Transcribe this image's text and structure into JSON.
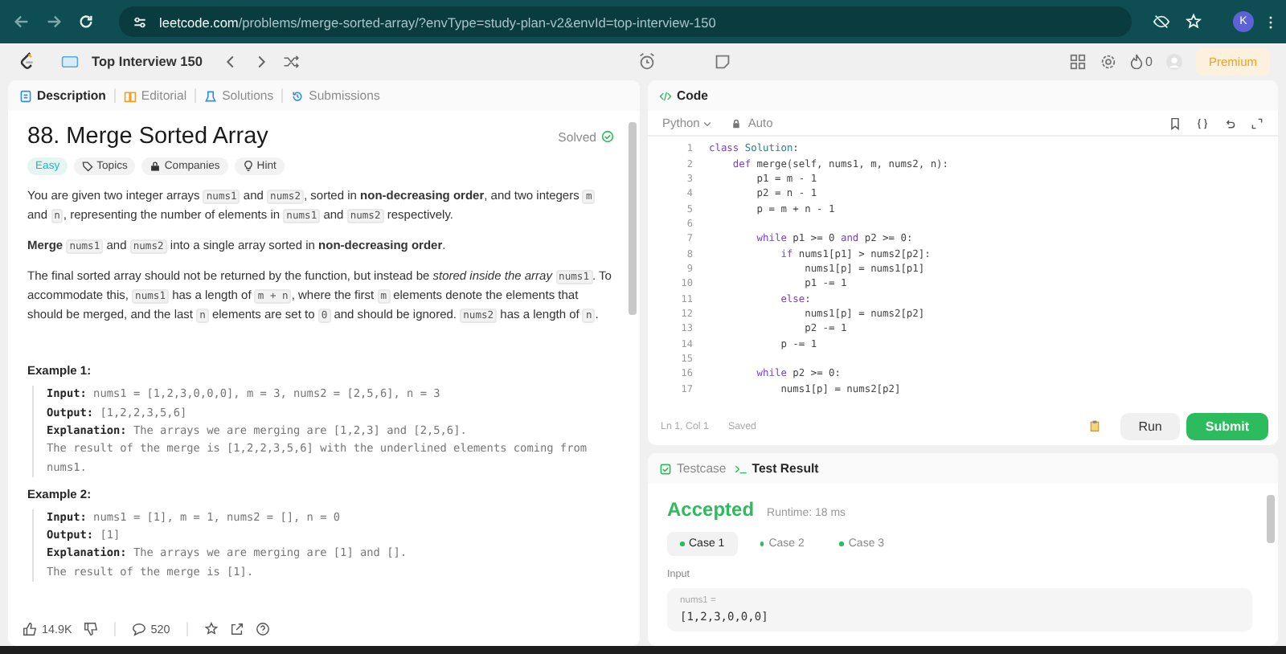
{
  "browser": {
    "url_host": "leetcode.com",
    "url_path": "/problems/merge-sorted-array/?envType=study-plan-v2&envId=top-interview-150",
    "profile_initial": "K"
  },
  "header": {
    "study_plan": "Top Interview 150",
    "streak": "0",
    "premium": "Premium"
  },
  "description_tabs": [
    {
      "label": "Description",
      "kind": "description",
      "selected": true
    },
    {
      "label": "Editorial",
      "kind": "editorial",
      "selected": false
    },
    {
      "label": "Solutions",
      "kind": "solutions",
      "selected": false
    },
    {
      "label": "Submissions",
      "kind": "submissions",
      "selected": false
    }
  ],
  "problem": {
    "title": "88. Merge Sorted Array",
    "status": "Solved",
    "tags": [
      {
        "label": "Easy",
        "kind": "difficulty"
      },
      {
        "label": "Topics",
        "kind": "topics"
      },
      {
        "label": "Companies",
        "kind": "companies"
      },
      {
        "label": "Hint",
        "kind": "hint"
      }
    ],
    "paragraphs": [
      [
        {
          "kind": "text",
          "text": "You are given two integer arrays "
        },
        {
          "kind": "code",
          "text": "nums1"
        },
        {
          "kind": "text",
          "text": " and "
        },
        {
          "kind": "code",
          "text": "nums2"
        },
        {
          "kind": "text",
          "text": ", sorted in "
        },
        {
          "kind": "bold",
          "text": "non-decreasing order"
        },
        {
          "kind": "text",
          "text": ", and two integers "
        },
        {
          "kind": "code",
          "text": "m"
        },
        {
          "kind": "text",
          "text": " and "
        },
        {
          "kind": "code",
          "text": "n"
        },
        {
          "kind": "text",
          "text": ", representing the number of elements in "
        },
        {
          "kind": "code",
          "text": "nums1"
        },
        {
          "kind": "text",
          "text": " and "
        },
        {
          "kind": "code",
          "text": "nums2"
        },
        {
          "kind": "text",
          "text": " respectively."
        }
      ],
      [
        {
          "kind": "bold",
          "text": "Merge "
        },
        {
          "kind": "code",
          "text": "nums1"
        },
        {
          "kind": "text",
          "text": " and "
        },
        {
          "kind": "code",
          "text": "nums2"
        },
        {
          "kind": "text",
          "text": " into a single array sorted in "
        },
        {
          "kind": "bold",
          "text": "non-decreasing order"
        },
        {
          "kind": "text",
          "text": "."
        }
      ],
      [
        {
          "kind": "text",
          "text": "The final sorted array should not be returned by the function, but instead be "
        },
        {
          "kind": "italic",
          "text": "stored inside the array "
        },
        {
          "kind": "code",
          "text": "nums1"
        },
        {
          "kind": "text",
          "text": ". To accommodate this, "
        },
        {
          "kind": "code",
          "text": "nums1"
        },
        {
          "kind": "text",
          "text": " has a length of "
        },
        {
          "kind": "code",
          "text": "m + n"
        },
        {
          "kind": "text",
          "text": ", where the first "
        },
        {
          "kind": "code",
          "text": "m"
        },
        {
          "kind": "text",
          "text": " elements denote the elements that should be merged, and the last "
        },
        {
          "kind": "code",
          "text": "n"
        },
        {
          "kind": "text",
          "text": " elements are set to "
        },
        {
          "kind": "code",
          "text": "0"
        },
        {
          "kind": "text",
          "text": " and should be ignored. "
        },
        {
          "kind": "code",
          "text": "nums2"
        },
        {
          "kind": "text",
          "text": " has a length of "
        },
        {
          "kind": "code",
          "text": "n"
        },
        {
          "kind": "text",
          "text": "."
        }
      ]
    ],
    "examples": [
      {
        "title": "Example 1:",
        "lines": [
          {
            "label": "Input:",
            "text": " nums1 = [1,2,3,0,0,0], m = 3, nums2 = [2,5,6], n = 3"
          },
          {
            "label": "Output:",
            "text": " [1,2,2,3,5,6]"
          },
          {
            "label": "Explanation:",
            "text": " The arrays we are merging are [1,2,3] and [2,5,6]."
          },
          {
            "text": "The result of the merge is [1,2,2,3,5,6] with the underlined elements coming from nums1."
          }
        ]
      },
      {
        "title": "Example 2:",
        "lines": [
          {
            "label": "Input:",
            "text": " nums1 = [1], m = 1, nums2 = [], n = 0"
          },
          {
            "label": "Output:",
            "text": " [1]"
          },
          {
            "label": "Explanation:",
            "text": " The arrays we are merging are [1] and []."
          },
          {
            "text": "The result of the merge is [1]."
          }
        ]
      }
    ]
  },
  "footer": {
    "likes": "14.9K",
    "comments": "520"
  },
  "editor": {
    "tab": "Code",
    "language": "Python",
    "mode": "Auto",
    "cursor": "Ln 1, Col 1",
    "save_state": "Saved",
    "run": "Run",
    "submit": "Submit",
    "lines": [
      {
        "n": "1",
        "code": [
          {
            "kind": "kw",
            "text": "class"
          },
          {
            "kind": "type",
            "text": " Solution"
          },
          {
            "kind": "plain",
            "text": ":"
          }
        ]
      },
      {
        "n": "2",
        "code": [
          {
            "kind": "kw",
            "text": "    def"
          },
          {
            "kind": "plain",
            "text": " merge(self, nums1, m, nums2, n):"
          }
        ]
      },
      {
        "n": "3",
        "code": [
          {
            "kind": "plain",
            "text": "        p1 = m - 1"
          }
        ]
      },
      {
        "n": "4",
        "code": [
          {
            "kind": "plain",
            "text": "        p2 = n - 1"
          }
        ]
      },
      {
        "n": "5",
        "code": [
          {
            "kind": "plain",
            "text": "        p = m + n - 1"
          }
        ]
      },
      {
        "n": "6"
      },
      {
        "n": "7",
        "code": [
          {
            "kind": "kw",
            "text": "        while"
          },
          {
            "kind": "plain",
            "text": " p1 >= 0 "
          },
          {
            "kind": "kw",
            "text": "and"
          },
          {
            "kind": "plain",
            "text": " p2 >= 0:"
          }
        ]
      },
      {
        "n": "8",
        "code": [
          {
            "kind": "kw",
            "text": "            if"
          },
          {
            "kind": "plain",
            "text": " nums1[p1] > nums2[p2]:"
          }
        ]
      },
      {
        "n": "9",
        "code": [
          {
            "kind": "plain",
            "text": "                nums1[p] = nums1[p1]"
          }
        ]
      },
      {
        "n": "10",
        "code": [
          {
            "kind": "plain",
            "text": "                p1 -= 1"
          }
        ]
      },
      {
        "n": "11",
        "code": [
          {
            "kind": "kw",
            "text": "            else"
          },
          {
            "kind": "plain",
            "text": ":"
          }
        ]
      },
      {
        "n": "12",
        "code": [
          {
            "kind": "plain",
            "text": "                nums1[p] = nums2[p2]"
          }
        ]
      },
      {
        "n": "13",
        "code": [
          {
            "kind": "plain",
            "text": "                p2 -= 1"
          }
        ]
      },
      {
        "n": "14",
        "code": [
          {
            "kind": "plain",
            "text": "            p -= 1"
          }
        ]
      },
      {
        "n": "15"
      },
      {
        "n": "16",
        "code": [
          {
            "kind": "kw",
            "text": "        while"
          },
          {
            "kind": "plain",
            "text": " p2 >= 0:"
          }
        ]
      },
      {
        "n": "17",
        "code": [
          {
            "kind": "plain",
            "text": "            nums1[p] = nums2[p2]"
          }
        ]
      }
    ]
  },
  "console": {
    "tabs": [
      {
        "label": "Testcase",
        "kind": "testcase",
        "selected": false
      },
      {
        "label": "Test Result",
        "kind": "result",
        "selected": true
      }
    ],
    "verdict": "Accepted",
    "runtime": "Runtime: 18 ms",
    "cases": [
      {
        "label": "Case 1",
        "selected": true
      },
      {
        "label": "Case 2",
        "selected": false
      },
      {
        "label": "Case 3",
        "selected": false
      }
    ],
    "input_label": "Input",
    "param_name": "nums1 =",
    "param_value": "[1,2,3,0,0,0]"
  }
}
